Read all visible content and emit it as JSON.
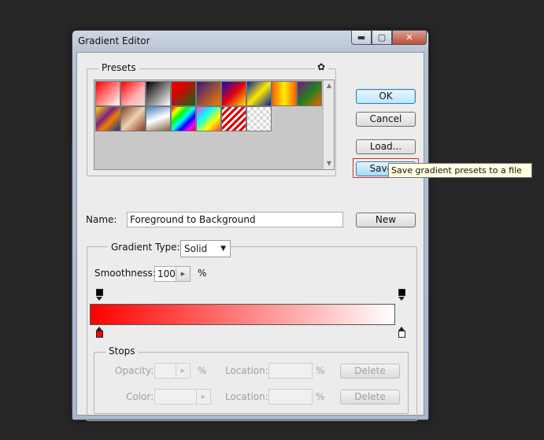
{
  "window": {
    "title": "Gradient Editor",
    "controls": {
      "minimize": "▬",
      "maximize": "▢",
      "close": "✕"
    }
  },
  "presets": {
    "legend": "Presets",
    "menu_icon": "gear-icon",
    "menu_glyph": "✿",
    "swatches": [
      {
        "name": "red-to-white",
        "css": "linear-gradient(135deg,#ff0000,#ffffff)"
      },
      {
        "name": "red-to-transparent",
        "css": "linear-gradient(135deg,#ff0000,#ffb0b0 60%,#e0e0e0)"
      },
      {
        "name": "black-to-white",
        "css": "linear-gradient(135deg,#000000,#ffffff)"
      },
      {
        "name": "red-green",
        "css": "linear-gradient(135deg,#e00000 30%,#0a6a1a)"
      },
      {
        "name": "violet-orange",
        "css": "linear-gradient(135deg,#3a1a7a,#f08000)"
      },
      {
        "name": "blue-red-yellow",
        "css": "linear-gradient(135deg,#1010c0,#e00010,#ffe000)"
      },
      {
        "name": "blue-yellow-blue",
        "css": "linear-gradient(135deg,#0020a0,#ffe800 50%,#0020a0)"
      },
      {
        "name": "orange-yellow-orange",
        "css": "linear-gradient(to right,#ff6000,#ffee00 50%,#ff6000)"
      },
      {
        "name": "violet-green-orange",
        "css": "linear-gradient(135deg,#801080,#208020 50%,#f06000)"
      },
      {
        "name": "yellow-violet-orange-blue",
        "css": "linear-gradient(135deg,#ffdd00,#802080 40%,#f08000 60%,#1030a0)"
      },
      {
        "name": "copper",
        "css": "linear-gradient(135deg,#804020,#f0d0b0 50%,#804020)"
      },
      {
        "name": "chrome",
        "css": "linear-gradient(160deg,#4080c0,#ffffff 50%,#806040)"
      },
      {
        "name": "spectrum",
        "css": "linear-gradient(135deg,#ff0000,#ffff00,#00ff00,#00ffff,#0000ff,#ff00ff,#ff0000)"
      },
      {
        "name": "transparent-rainbow",
        "css": "linear-gradient(135deg,#ff40ff,#00ffff,#ffff00,#ff4040)"
      },
      {
        "name": "transparent-stripes",
        "css": "repeating-linear-gradient(135deg,#e00000 0 3px,#ffffff 3px 6px)"
      },
      {
        "name": "transparent",
        "css": "repeating-conic-gradient(#d8d8d8 0 25%,#ffffff 0 50%) 0 0/8px 8px"
      }
    ]
  },
  "buttons": {
    "ok": "OK",
    "cancel": "Cancel",
    "load": "Load...",
    "save": "Save...",
    "new": "New",
    "delete_opacity": "Delete",
    "delete_color": "Delete"
  },
  "tooltip": "Save gradient presets to a file",
  "name_field": {
    "label": "Name:",
    "value": "Foreground to Background"
  },
  "gradient": {
    "type_label": "Gradient Type:",
    "type_value": "Solid",
    "smoothness_label": "Smoothness:",
    "smoothness_value": "100",
    "smoothness_unit": "%",
    "start_color": "#ff0000",
    "end_color": "#ffffff"
  },
  "stops": {
    "legend": "Stops",
    "opacity_label": "Opacity:",
    "opacity_unit": "%",
    "color_label": "Color:",
    "location_label": "Location:",
    "location_unit": "%"
  }
}
